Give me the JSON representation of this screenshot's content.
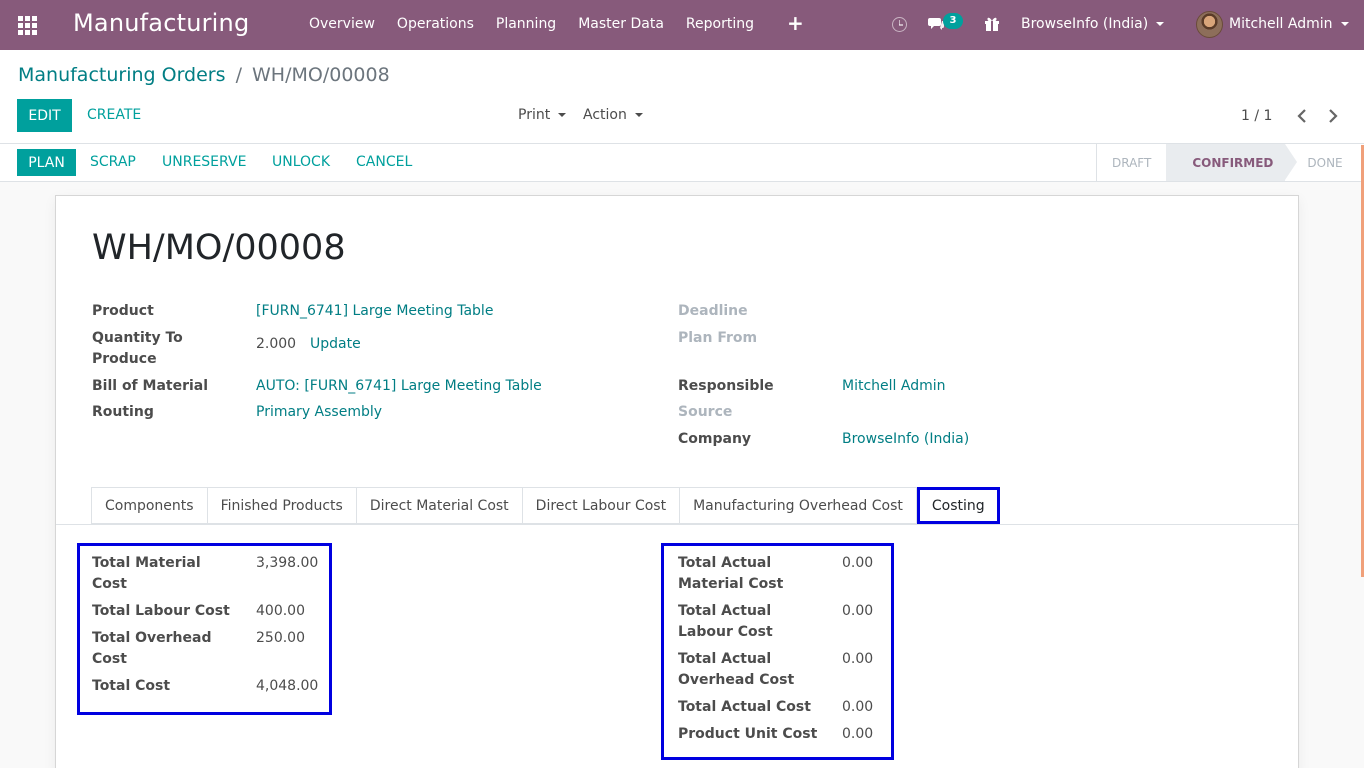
{
  "navbar": {
    "app_name": "Manufacturing",
    "menu": [
      "Overview",
      "Operations",
      "Planning",
      "Master Data",
      "Reporting"
    ],
    "chat_count": "3",
    "company": "BrowseInfo (India)",
    "user": "Mitchell Admin",
    "color": "#875a7b"
  },
  "breadcrumb": {
    "parent": "Manufacturing Orders",
    "separator": "/",
    "current": "WH/MO/00008"
  },
  "toolbar": {
    "edit": "Edit",
    "create": "Create",
    "print": "Print",
    "action": "Action",
    "pager": "1 / 1"
  },
  "statusbar": {
    "buttons": [
      "Plan",
      "Scrap",
      "Unreserve",
      "Unlock",
      "Cancel"
    ],
    "steps": [
      "Draft",
      "Confirmed",
      "Done"
    ],
    "active_step": "Confirmed"
  },
  "record": {
    "title": "WH/MO/00008",
    "left_fields": {
      "product_label": "Product",
      "product_value": "[FURN_6741] Large Meeting Table",
      "qty_label_1": "Quantity To",
      "qty_label_2": "Produce",
      "qty_value": "2.000",
      "qty_update": "Update",
      "bom_label": "Bill of Material",
      "bom_value": "AUTO: [FURN_6741] Large Meeting Table",
      "routing_label": "Routing",
      "routing_value": "Primary Assembly"
    },
    "right_fields": {
      "deadline_label": "Deadline",
      "plan_from_label": "Plan From",
      "responsible_label": "Responsible",
      "responsible_value": "Mitchell Admin",
      "source_label": "Source",
      "company_label": "Company",
      "company_value": "BrowseInfo (India)"
    }
  },
  "tabs": [
    "Components",
    "Finished Products",
    "Direct Material Cost",
    "Direct Labour Cost",
    "Manufacturing Overhead Cost",
    "Costing"
  ],
  "active_tab": "Costing",
  "costing": {
    "planned": [
      {
        "label_1": "Total Material",
        "label_2": "Cost",
        "value": "3,398.00"
      },
      {
        "label_1": "Total Labour Cost",
        "label_2": "",
        "value": "400.00"
      },
      {
        "label_1": "Total Overhead",
        "label_2": "Cost",
        "value": "250.00"
      },
      {
        "label_1": "Total Cost",
        "label_2": "",
        "value": "4,048.00"
      }
    ],
    "actual": [
      {
        "label_1": "Total Actual",
        "label_2": "Material Cost",
        "value": "0.00"
      },
      {
        "label_1": "Total Actual",
        "label_2": "Labour Cost",
        "value": "0.00"
      },
      {
        "label_1": "Total Actual",
        "label_2": "Overhead Cost",
        "value": "0.00"
      },
      {
        "label_1": "Total Actual Cost",
        "label_2": "",
        "value": "0.00"
      },
      {
        "label_1": "Product Unit Cost",
        "label_2": "",
        "value": "0.00"
      }
    ],
    "highlight_color": "#0000e0"
  }
}
